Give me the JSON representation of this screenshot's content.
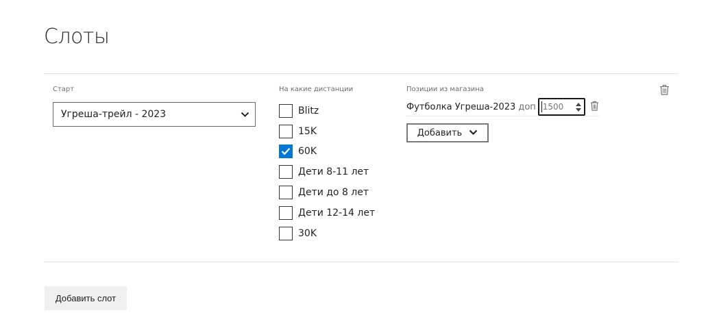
{
  "page": {
    "title": "Слоты"
  },
  "slot": {
    "start": {
      "label": "Старт",
      "selected": "Угреша-трейл - 2023",
      "icon": "chevron-down-icon"
    },
    "distances": {
      "label": "На какие дистанции",
      "items": [
        {
          "label": "Blitz",
          "checked": false
        },
        {
          "label": "15K",
          "checked": false
        },
        {
          "label": "60K",
          "checked": true
        },
        {
          "label": "Дети 8-11 лет",
          "checked": false
        },
        {
          "label": "Дети до 8 лет",
          "checked": false
        },
        {
          "label": "Дети 12-14 лет",
          "checked": false
        },
        {
          "label": "30K",
          "checked": false
        }
      ]
    },
    "shop": {
      "label": "Позиции из магазина",
      "positions": [
        {
          "name": "Футболка Угреша-2023",
          "extra_label": "доп",
          "price": "1500"
        }
      ],
      "add_label": "Добавить"
    }
  },
  "footer": {
    "add_slot_label": "Добавить слот"
  },
  "colors": {
    "accent": "#0078d4",
    "border": "#666666",
    "divider": "#e3e3e3",
    "button_bg": "#efefef"
  }
}
